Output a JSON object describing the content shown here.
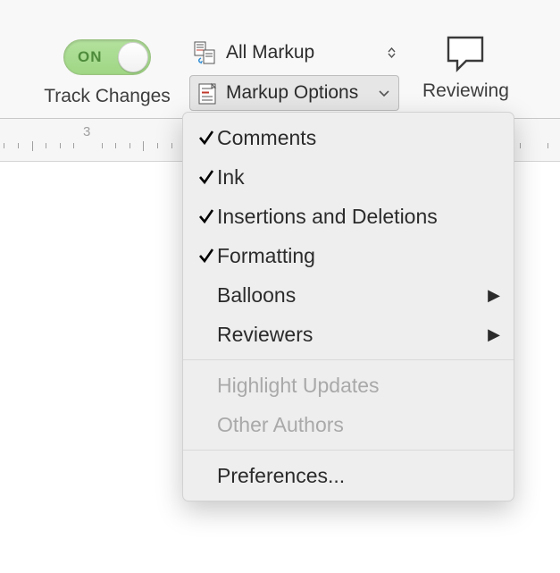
{
  "toolbar": {
    "track": {
      "state": "ON",
      "label": "Track Changes"
    },
    "markup": {
      "select_value": "All Markup",
      "options_label": "Markup Options"
    },
    "reviewing_label": "Reviewing"
  },
  "ruler": {
    "number": "3"
  },
  "menu": {
    "items": [
      {
        "label": "Comments",
        "checked": true,
        "enabled": true,
        "submenu": false
      },
      {
        "label": "Ink",
        "checked": true,
        "enabled": true,
        "submenu": false
      },
      {
        "label": "Insertions and Deletions",
        "checked": true,
        "enabled": true,
        "submenu": false
      },
      {
        "label": "Formatting",
        "checked": true,
        "enabled": true,
        "submenu": false
      },
      {
        "label": "Balloons",
        "checked": false,
        "enabled": true,
        "submenu": true
      },
      {
        "label": "Reviewers",
        "checked": false,
        "enabled": true,
        "submenu": true
      }
    ],
    "items2": [
      {
        "label": "Highlight Updates",
        "checked": false,
        "enabled": false,
        "submenu": false
      },
      {
        "label": "Other Authors",
        "checked": false,
        "enabled": false,
        "submenu": false
      }
    ],
    "items3": [
      {
        "label": "Preferences...",
        "checked": false,
        "enabled": true,
        "submenu": false
      }
    ]
  }
}
